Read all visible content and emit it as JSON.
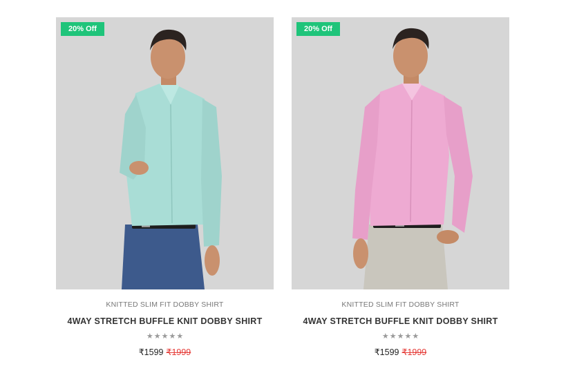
{
  "products": [
    {
      "badge": "20% Off",
      "subtitle": "KNITTED SLIM FIT DOBBY SHIRT",
      "title": "4WAY STRETCH BUFFLE KNIT DOBBY SHIRT",
      "rating": 0,
      "rating_max": 5,
      "price": "₹1599",
      "original_price": "₹1999",
      "shirt_color": "#a9ddd6",
      "pant_color": "#3d5a8c"
    },
    {
      "badge": "20% Off",
      "subtitle": "KNITTED SLIM FIT DOBBY SHIRT",
      "title": "4WAY STRETCH BUFFLE KNIT DOBBY SHIRT",
      "rating": 0,
      "rating_max": 5,
      "price": "₹1599",
      "original_price": "₹1999",
      "shirt_color": "#eeaad2",
      "pant_color": "#c9c6bd"
    }
  ],
  "colors": {
    "badge_bg": "#1fc47a",
    "strike_price": "#e53935",
    "image_bg": "#d6d6d6"
  },
  "icons": {
    "star": "star-icon"
  }
}
